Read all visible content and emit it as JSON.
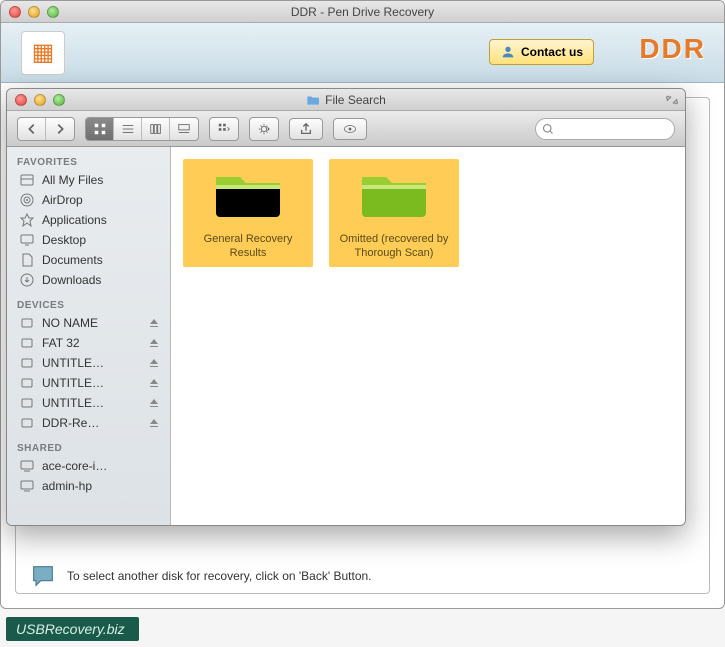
{
  "app": {
    "title": "DDR - Pen Drive Recovery",
    "contact_label": "Contact us",
    "brand": "DDR",
    "hint": "To select another disk for recovery, click on 'Back' Button."
  },
  "finder": {
    "title": "File Search",
    "search_placeholder": "",
    "sidebar": {
      "sections": [
        {
          "header": "FAVORITES",
          "items": [
            {
              "icon": "all-files",
              "label": "All My Files"
            },
            {
              "icon": "airdrop",
              "label": "AirDrop"
            },
            {
              "icon": "applications",
              "label": "Applications"
            },
            {
              "icon": "desktop",
              "label": "Desktop"
            },
            {
              "icon": "documents",
              "label": "Documents"
            },
            {
              "icon": "downloads",
              "label": "Downloads"
            }
          ]
        },
        {
          "header": "DEVICES",
          "items": [
            {
              "icon": "disk",
              "label": "NO NAME",
              "eject": true
            },
            {
              "icon": "disk",
              "label": "FAT 32",
              "eject": true
            },
            {
              "icon": "disk",
              "label": "UNTITLE…",
              "eject": true
            },
            {
              "icon": "disk",
              "label": "UNTITLE…",
              "eject": true
            },
            {
              "icon": "disk",
              "label": "UNTITLE…",
              "eject": true
            },
            {
              "icon": "disk",
              "label": "DDR-Re…",
              "eject": true
            }
          ]
        },
        {
          "header": "SHARED",
          "items": [
            {
              "icon": "computer",
              "label": "ace-core-i…"
            },
            {
              "icon": "computer",
              "label": "admin-hp"
            }
          ]
        }
      ]
    },
    "folders": [
      {
        "label": "General Recovery Results",
        "selected": true
      },
      {
        "label": "Omitted (recovered by Thorough Scan)",
        "selected": true
      }
    ]
  },
  "watermark": "USBRecovery.biz"
}
